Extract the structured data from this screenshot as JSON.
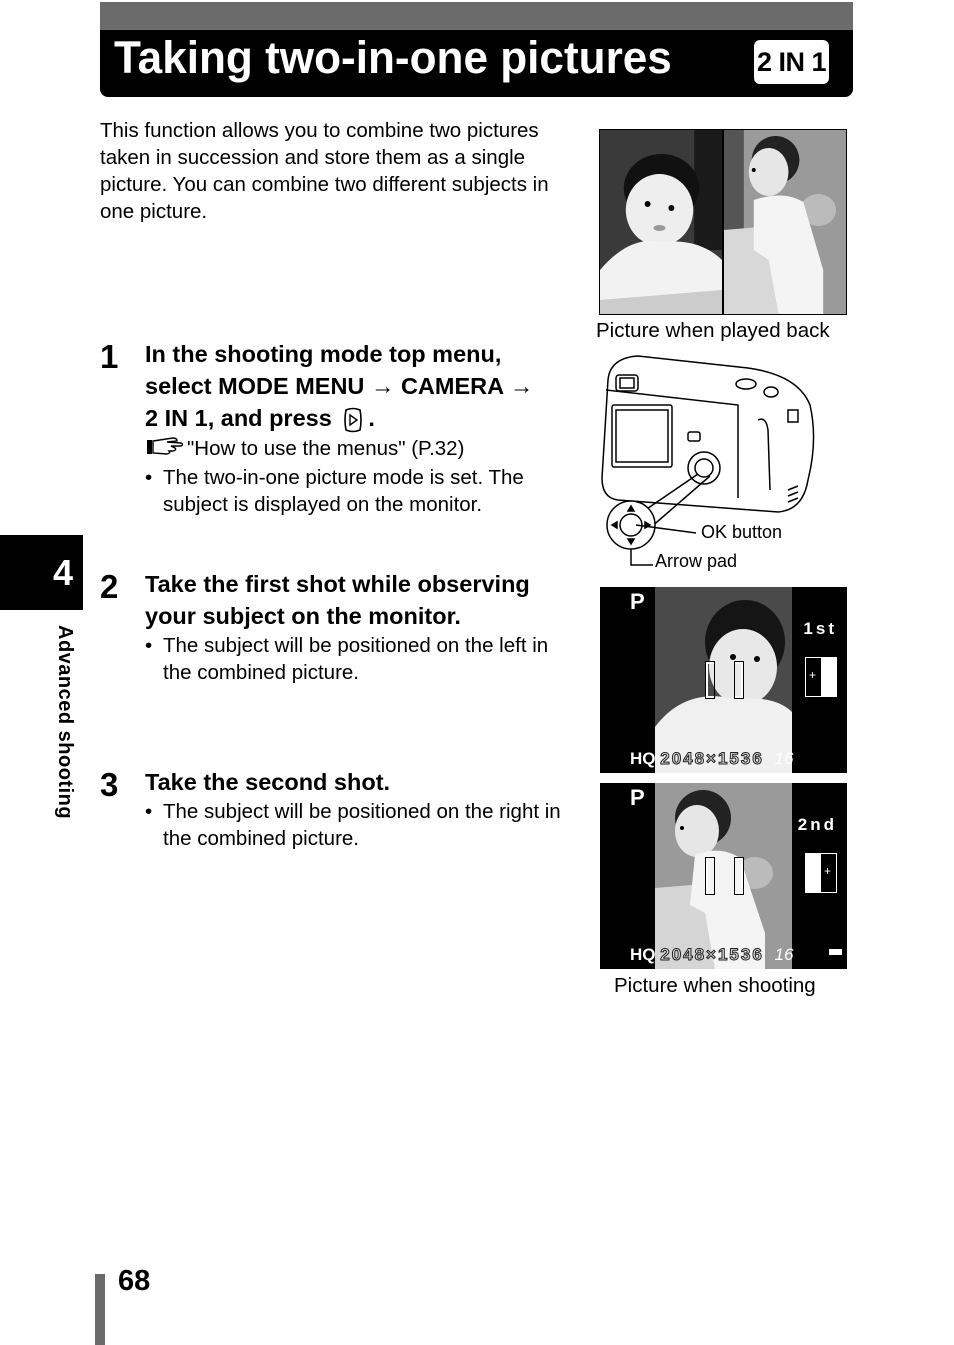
{
  "header": {
    "title": "Taking two-in-one pictures",
    "badge": "2 IN 1"
  },
  "intro": "This function allows you to combine two pictures taken in succession and store them as a single picture. You can combine two different subjects in one picture.",
  "figures": {
    "playback_caption": "Picture when played back",
    "ok_button_label": "OK button",
    "arrow_pad_label": "Arrow pad",
    "shooting_caption": "Picture when shooting",
    "lcd_first": {
      "mode": "P",
      "shot": "1st",
      "quality": "HQ",
      "resolution": "2048×1536",
      "remaining": "16"
    },
    "lcd_second": {
      "mode": "P",
      "shot": "2nd",
      "quality": "HQ",
      "resolution": "2048×1536",
      "remaining": "16"
    }
  },
  "steps": [
    {
      "number": "1",
      "heading_line1": "In the shooting mode top menu,",
      "heading_line2": "select MODE MENU → CAMERA →",
      "heading_line3a": "2 IN 1, and press",
      "heading_line3b": ".",
      "reference": "\"How to use the menus\" (P.32)",
      "bullet": "The two-in-one picture mode is set. The subject is displayed on the monitor."
    },
    {
      "number": "2",
      "heading": "Take the first shot while observing your subject on the monitor.",
      "bullet": "The subject will be positioned on the left in the combined picture."
    },
    {
      "number": "3",
      "heading": "Take the second shot.",
      "bullet": "The subject will be positioned on the right in the combined picture."
    }
  ],
  "chapter": {
    "number": "4",
    "label": "Advanced shooting"
  },
  "footer": {
    "page_number": "68"
  }
}
